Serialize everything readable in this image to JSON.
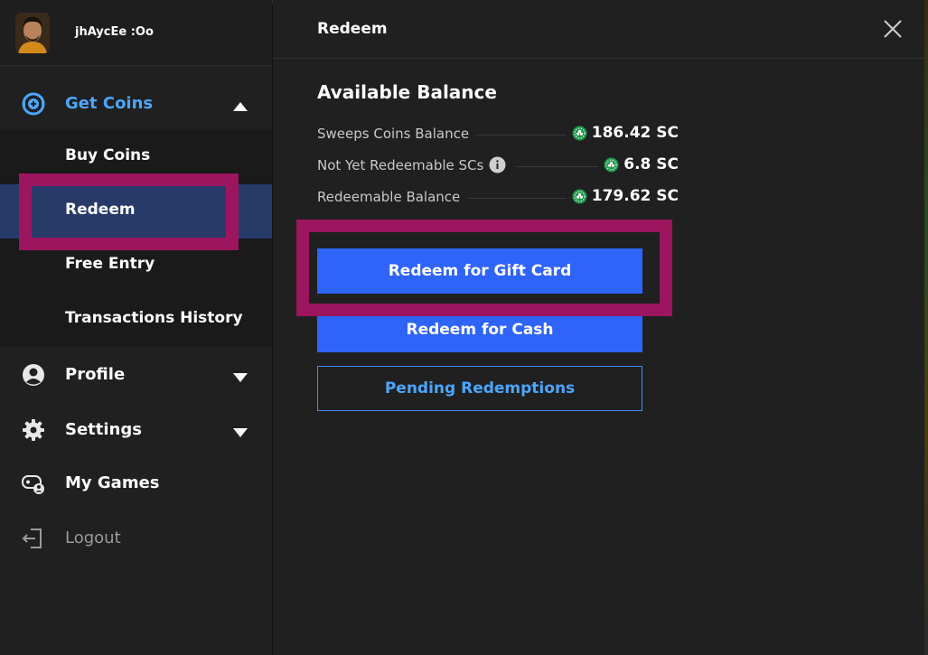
{
  "user": {
    "name": "jhAycEe :Oo"
  },
  "sidebar": {
    "get_coins": {
      "label": "Get Coins",
      "icon": "coins-target-icon"
    },
    "sub_items": [
      {
        "label": "Buy Coins"
      },
      {
        "label": "Redeem"
      },
      {
        "label": "Free Entry"
      },
      {
        "label": "Transactions History"
      }
    ],
    "profile": {
      "label": "Profile",
      "icon": "user-circle-icon"
    },
    "settings": {
      "label": "Settings",
      "icon": "gear-icon"
    },
    "my_games": {
      "label": "My Games",
      "icon": "games-icon"
    },
    "logout": {
      "label": "Logout",
      "icon": "logout-icon"
    }
  },
  "main": {
    "title": "Redeem",
    "balance_title": "Available Balance",
    "balances": [
      {
        "label": "Sweeps Coins Balance",
        "value": "186.42 SC"
      },
      {
        "label": "Not Yet Redeemable SCs",
        "value": "6.8 SC"
      },
      {
        "label": "Redeemable Balance",
        "value": "179.62 SC"
      }
    ],
    "buttons": {
      "gift_card": "Redeem for Gift Card",
      "cash": "Redeem for Cash",
      "pending": "Pending Redemptions"
    }
  },
  "colors": {
    "accent": "#4ba6ff",
    "primary_button": "#2f64fb",
    "highlight": "#9b155f",
    "selected_bg": "#283a6a",
    "coin_green": "#1d9a4a"
  }
}
